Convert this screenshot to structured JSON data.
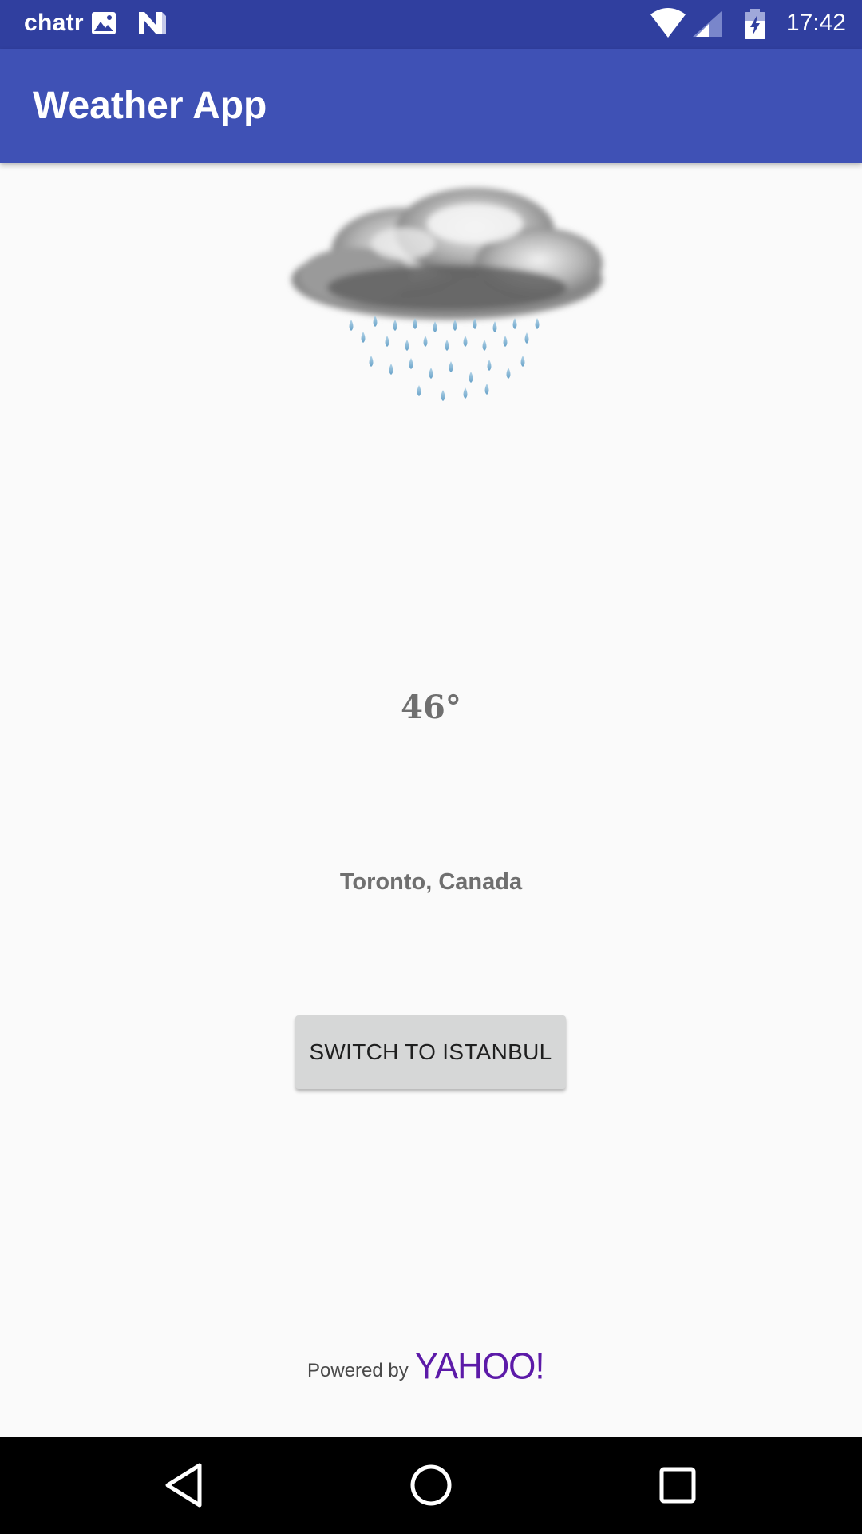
{
  "status_bar": {
    "carrier": "chatr",
    "time": "17:42",
    "icons": [
      "image-notification-icon",
      "n-notification-icon",
      "wifi-icon",
      "cell-signal-icon",
      "battery-charging-icon"
    ],
    "color": "#303f9f"
  },
  "app_bar": {
    "title": "Weather App",
    "color": "#3f51b5"
  },
  "weather": {
    "condition_icon": "rain-cloud-icon",
    "temperature": "46°",
    "location": "Toronto, Canada"
  },
  "switch_button": {
    "label": "SWITCH TO ISTANBUL"
  },
  "attribution": {
    "prefix": "Powered by",
    "brand": "YAHOO!",
    "brand_color": "#5c1aa8"
  },
  "nav_bar": {
    "buttons": [
      "back-icon",
      "home-icon",
      "recents-icon"
    ]
  }
}
